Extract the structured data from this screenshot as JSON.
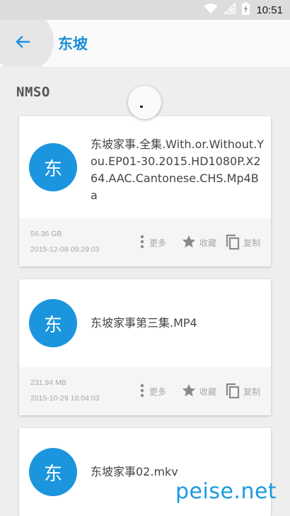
{
  "status_bar": {
    "time": "10:51"
  },
  "app_bar": {
    "title": "东坡"
  },
  "section": {
    "title": "NMSO"
  },
  "files": [
    {
      "avatar_letter": "东",
      "name": "东坡家事.全集.With.or.Without.You.EP01-30.2015.HD1080P.X264.AAC.Cantonese.CHS.Mp4Ba",
      "size": "56.36 GB",
      "date": "2015-12-08 09:29:03",
      "more_label": "更多",
      "favorite_label": "收藏",
      "copy_label": "复制"
    },
    {
      "avatar_letter": "东",
      "name": "东坡家事第三集.MP4",
      "size": "231.94 MB",
      "date": "2015-10-29 18:04:03",
      "more_label": "更多",
      "favorite_label": "收藏",
      "copy_label": "复制"
    },
    {
      "avatar_letter": "东",
      "name": "东坡家事02.mkv"
    }
  ],
  "watermark": "peise.net",
  "colors": {
    "accent": "#1b95dd",
    "title": "#1a8fd6",
    "muted": "#a8a8a8"
  },
  "icons": [
    "wifi-icon",
    "no-signal-icon",
    "battery-charging-icon",
    "back-arrow-icon",
    "more-vert-icon",
    "star-icon",
    "copy-icon"
  ]
}
